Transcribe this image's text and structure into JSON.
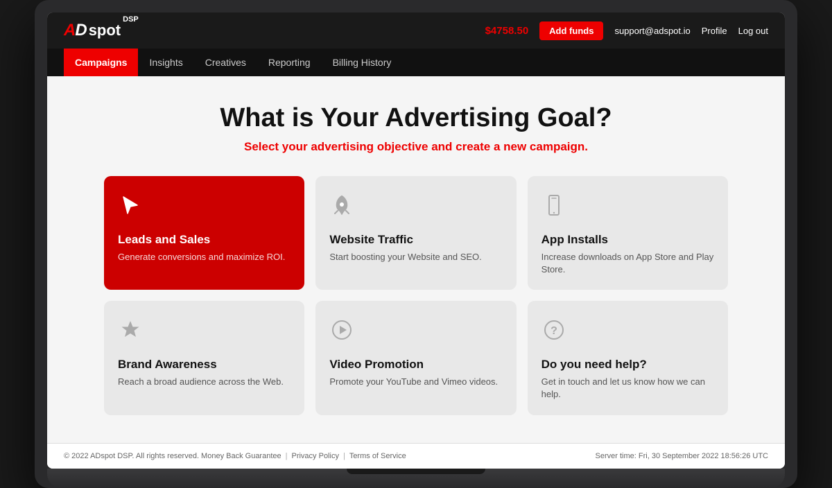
{
  "header": {
    "logo_ad": "AD",
    "logo_spot": "spot",
    "logo_dsp": "DSP",
    "balance": "$4758.50",
    "add_funds_label": "Add funds",
    "support_email": "support@adspot.io",
    "profile_label": "Profile",
    "logout_label": "Log out"
  },
  "nav": {
    "tabs": [
      {
        "label": "Campaigns",
        "active": true
      },
      {
        "label": "Insights",
        "active": false
      },
      {
        "label": "Creatives",
        "active": false
      },
      {
        "label": "Reporting",
        "active": false
      },
      {
        "label": "Billing History",
        "active": false
      }
    ]
  },
  "main": {
    "heading": "What is Your Advertising Goal?",
    "subheading": "Select your advertising objective and create a new campaign.",
    "cards": [
      {
        "id": "leads-sales",
        "icon": "cursor",
        "title": "Leads and Sales",
        "desc": "Generate conversions and maximize ROI.",
        "active": true
      },
      {
        "id": "website-traffic",
        "icon": "rocket",
        "title": "Website Traffic",
        "desc": "Start boosting your Website and SEO.",
        "active": false
      },
      {
        "id": "app-installs",
        "icon": "mobile",
        "title": "App Installs",
        "desc": "Increase downloads on App Store and Play Store.",
        "active": false
      },
      {
        "id": "brand-awareness",
        "icon": "star",
        "title": "Brand Awareness",
        "desc": "Reach a broad audience across the Web.",
        "active": false
      },
      {
        "id": "video-promotion",
        "icon": "play",
        "title": "Video Promotion",
        "desc": "Promote your YouTube and Vimeo videos.",
        "active": false
      },
      {
        "id": "help",
        "icon": "question",
        "title": "Do you need help?",
        "desc": "Get in touch and let us know how we can help.",
        "active": false
      }
    ]
  },
  "footer": {
    "copyright": "© 2022 ADspot DSP. All rights reserved. Money Back Guarantee",
    "privacy_label": "Privacy Policy",
    "terms_label": "Terms of Service",
    "server_time": "Server time: Fri, 30 September 2022 18:56:26 UTC"
  }
}
